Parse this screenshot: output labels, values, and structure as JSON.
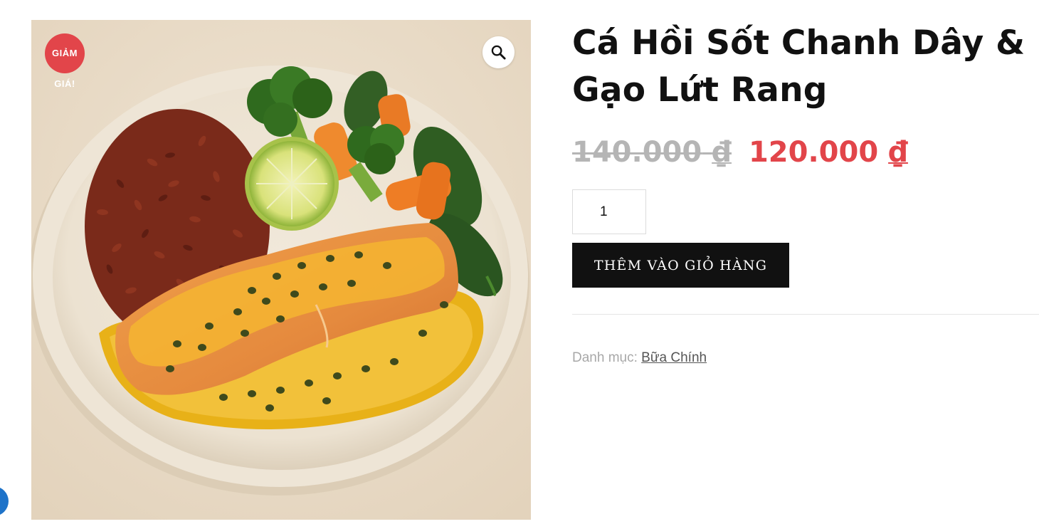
{
  "product": {
    "title": "Cá Hồi Sốt Chanh Dây & Gạo Lứt Rang",
    "regular_price_amount": "140.000",
    "sale_price_amount": "120.000",
    "currency_symbol": "₫",
    "quantity": "1",
    "add_to_cart_label": "THÊM VÀO GIỎ HÀNG",
    "category_label": "Danh mục:",
    "category_link": "Bữa Chính"
  },
  "badge": {
    "line1": "GIẢM",
    "line2": "GIÁ!"
  },
  "icons": {
    "zoom": "magnifier-icon",
    "chat": "chat-bubble-icon"
  },
  "colors": {
    "sale_accent": "#e2454a",
    "button_bg": "#111111",
    "old_price": "#b5b5b5",
    "chat_bubble": "#1e73c9"
  }
}
